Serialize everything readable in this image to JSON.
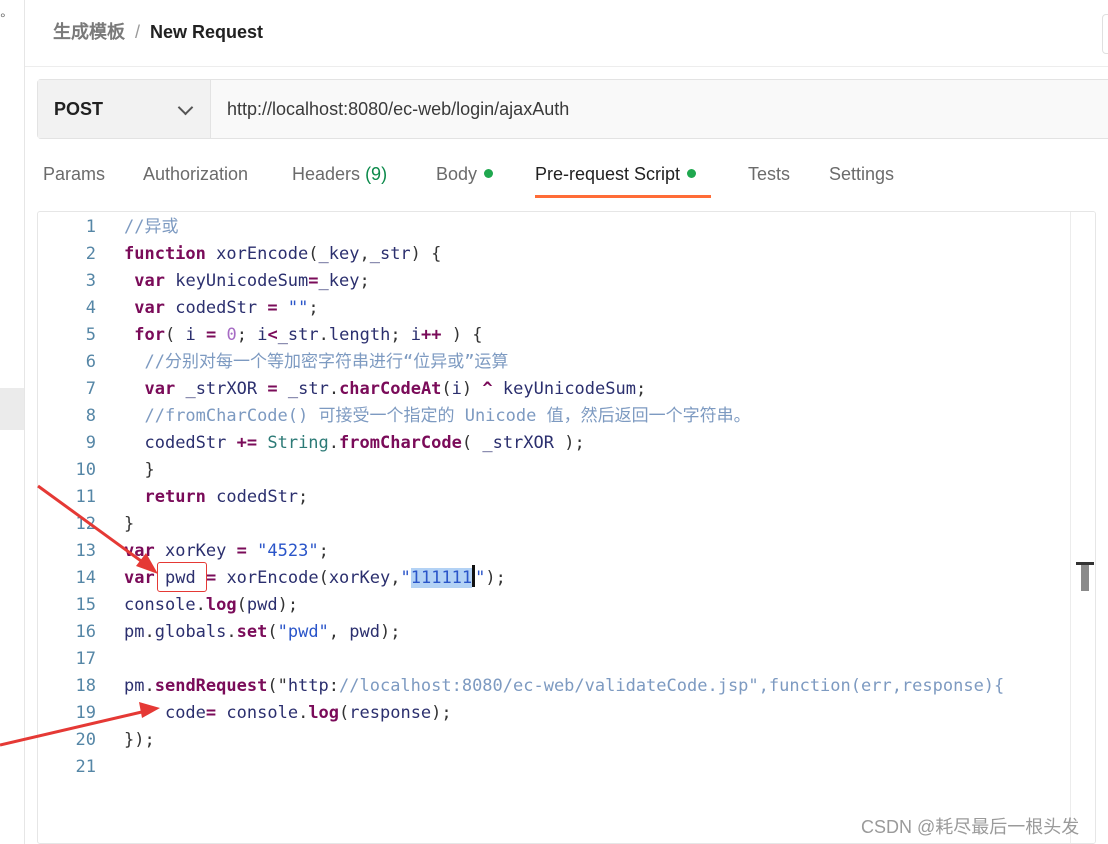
{
  "breadcrumb": {
    "parent": "生成模板",
    "separator": "/",
    "current": "New Request"
  },
  "request": {
    "method": "POST",
    "url": "http://localhost:8080/ec-web/login/ajaxAuth"
  },
  "tabs": [
    {
      "label": "Params"
    },
    {
      "label": "Authorization"
    },
    {
      "label": "Headers",
      "count": "(9)"
    },
    {
      "label": "Body",
      "dot": true
    },
    {
      "label": "Pre-request Script",
      "dot": true,
      "active": true
    },
    {
      "label": "Tests"
    },
    {
      "label": "Settings"
    }
  ],
  "editor": {
    "line_numbers": [
      "1",
      "2",
      "3",
      "4",
      "5",
      "6",
      "7",
      "8",
      "9",
      "10",
      "11",
      "12",
      "13",
      "14",
      "15",
      "16",
      "17",
      "18",
      "19",
      "20",
      "21"
    ],
    "lines": [
      "//异或",
      "function xorEncode(_key,_str) {",
      " var keyUnicodeSum=_key;",
      " var codedStr = \"\";",
      " for( i = 0; i<_str.length; i++ ) {",
      "  //分别对每一个等加密字符串进行“位异或”运算",
      "  var _strXOR = _str.charCodeAt(i) ^ keyUnicodeSum;",
      "  //fromCharCode() 可接受一个指定的 Unicode 值，然后返回一个字符串。",
      "  codedStr += String.fromCharCode( _strXOR );",
      "  }",
      "  return codedStr;",
      "}",
      "var xorKey = \"4523\";",
      "var pwd = xorEncode(xorKey,\"111111\");",
      "console.log(pwd);",
      "pm.globals.set(\"pwd\", pwd);",
      "",
      "pm.sendRequest(\"http://localhost:8080/ec-web/validateCode.jsp\",function(err,response){",
      "    code= console.log(response);",
      "});",
      ""
    ],
    "selected_text": "111111"
  },
  "watermark": "CSDN @耗尽最后一根头发",
  "colors": {
    "accent_orange": "#ff6c37",
    "dot_green": "#1fa84f",
    "annotation_red": "#e53935"
  }
}
